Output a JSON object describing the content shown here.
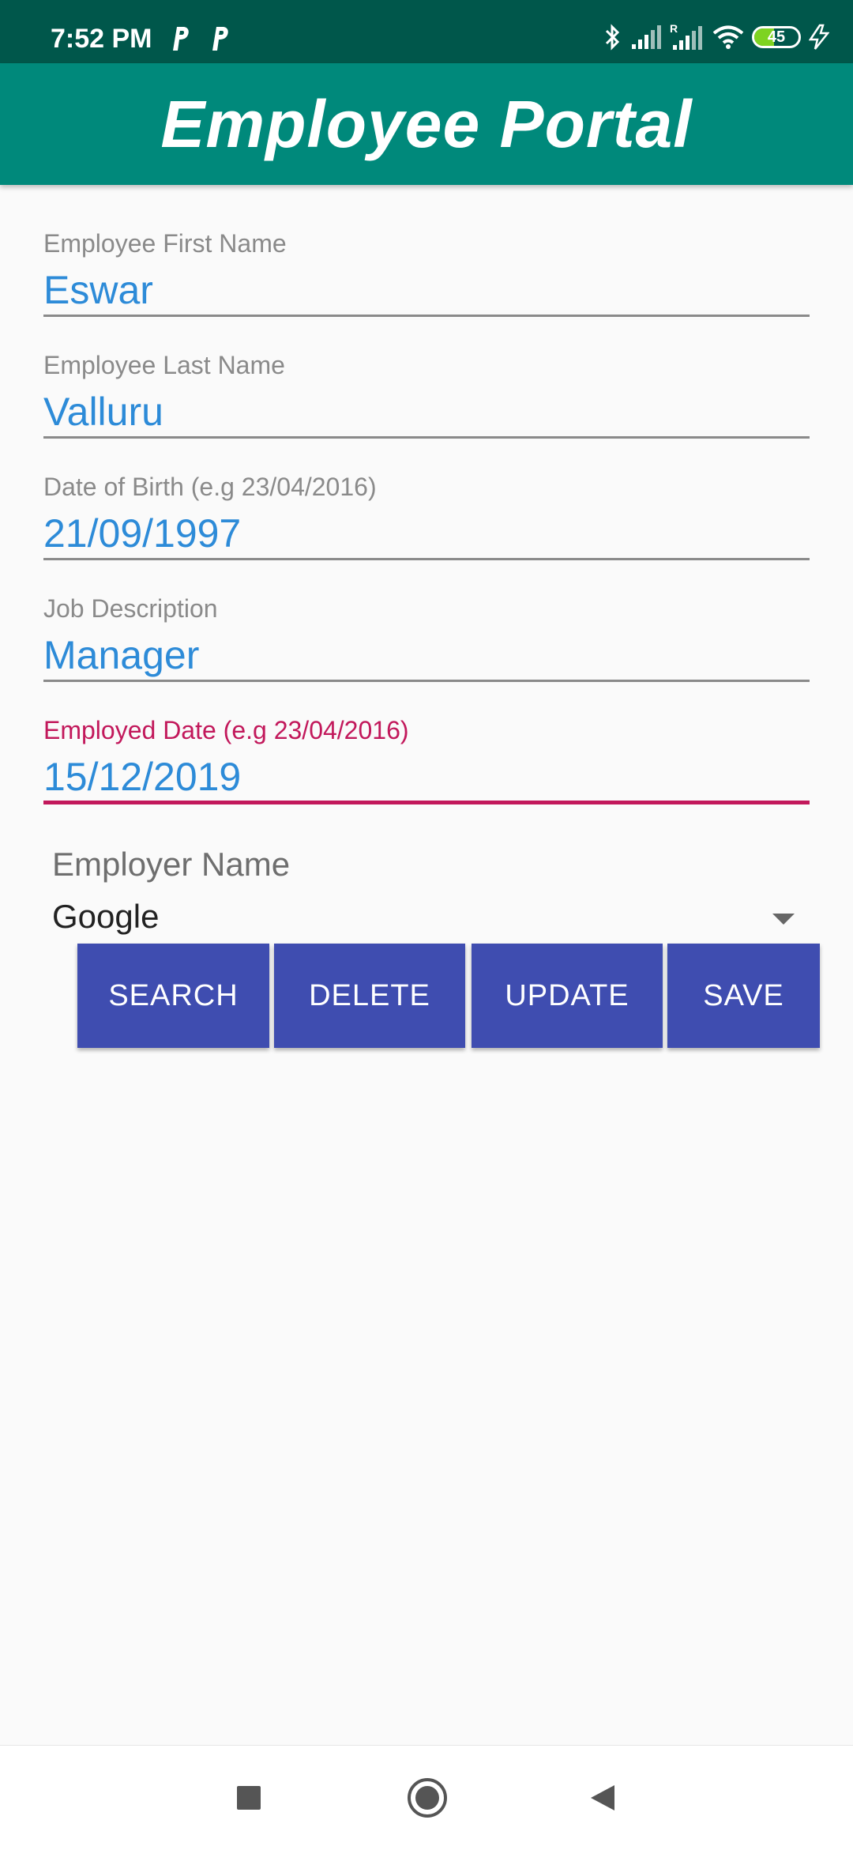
{
  "status_bar": {
    "time": "7:52 PM",
    "battery": "45",
    "icons": [
      "parking-notification-icon",
      "parking-notification-icon",
      "bluetooth-icon",
      "signal-icon",
      "signal-roaming-icon",
      "wifi-icon",
      "battery-icon",
      "charging-icon"
    ]
  },
  "app_bar": {
    "title": "Employee Portal"
  },
  "form": {
    "first_name": {
      "label": "Employee First Name",
      "value": "Eswar"
    },
    "last_name": {
      "label": "Employee Last Name",
      "value": "Valluru"
    },
    "dob": {
      "label": "Date of Birth (e.g 23/04/2016)",
      "value": "21/09/1997"
    },
    "job": {
      "label": "Job Description",
      "value": "Manager"
    },
    "employed_date": {
      "label": "Employed Date (e.g 23/04/2016)",
      "value": "15/12/2019"
    },
    "employer": {
      "label": "Employer Name",
      "value": "Google"
    }
  },
  "buttons": {
    "search": "SEARCH",
    "delete": "DELETE",
    "update": "UPDATE",
    "save": "SAVE"
  },
  "colors": {
    "status_bar": "#00574b",
    "app_bar": "#00897b",
    "value_text": "#2d8bd8",
    "focus_accent": "#c2185b",
    "button": "#3f4db0"
  },
  "nav": {
    "icons": [
      "recents-square-icon",
      "home-circle-icon",
      "back-triangle-icon"
    ]
  }
}
